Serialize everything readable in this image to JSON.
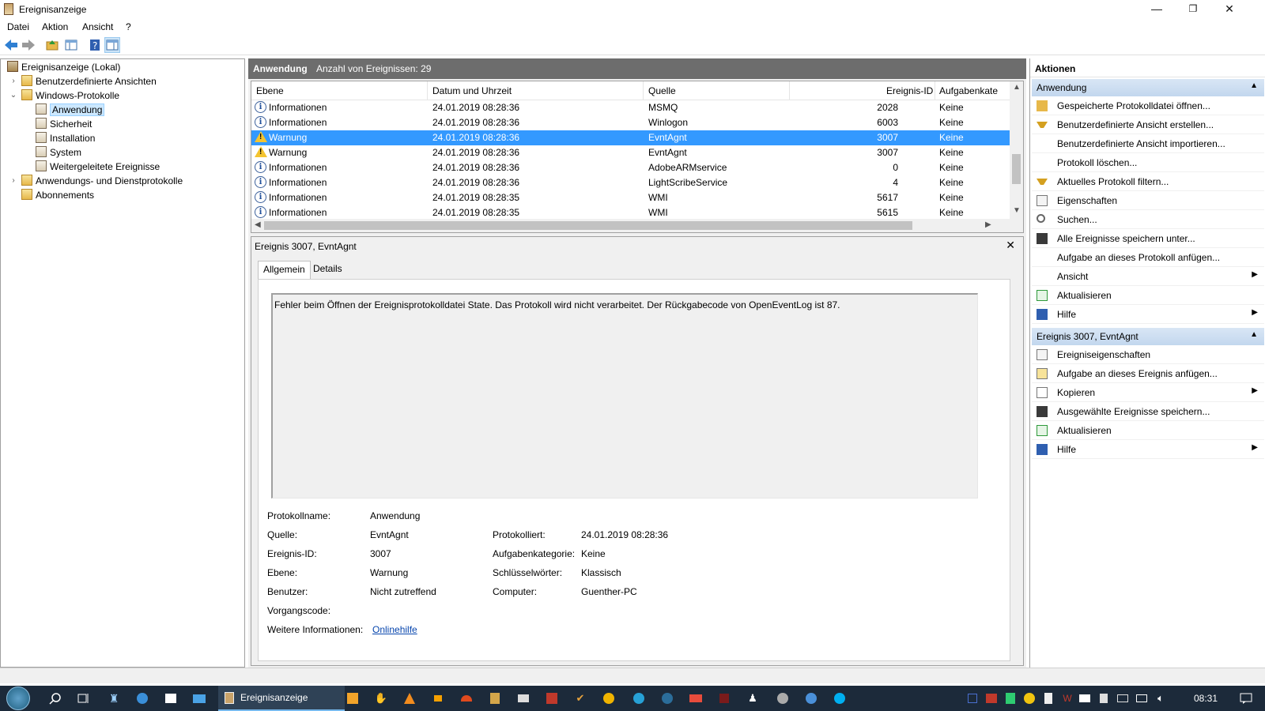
{
  "window": {
    "title": "Ereignisanzeige",
    "minimize": "—",
    "maximize": "❐",
    "close": "✕"
  },
  "menu": [
    "Datei",
    "Aktion",
    "Ansicht",
    "?"
  ],
  "tree": {
    "root": "Ereignisanzeige (Lokal)",
    "custom_views": "Benutzerdefinierte Ansichten",
    "windows_logs": "Windows-Protokolle",
    "logs": [
      "Anwendung",
      "Sicherheit",
      "Installation",
      "System",
      "Weitergeleitete Ereignisse"
    ],
    "app_service_logs": "Anwendungs- und Dienstprotokolle",
    "subscriptions": "Abonnements"
  },
  "center": {
    "header_title": "Anwendung",
    "header_count": "Anzahl von Ereignissen: 29",
    "columns": [
      "Ebene",
      "Datum und Uhrzeit",
      "Quelle",
      "Ereignis-ID",
      "Aufgabenkate"
    ],
    "rows": [
      {
        "level": "Informationen",
        "date": "24.01.2019 08:28:36",
        "source": "MSMQ",
        "id": "2028",
        "task": "Keine",
        "type": "info"
      },
      {
        "level": "Informationen",
        "date": "24.01.2019 08:28:36",
        "source": "Winlogon",
        "id": "6003",
        "task": "Keine",
        "type": "info"
      },
      {
        "level": "Warnung",
        "date": "24.01.2019 08:28:36",
        "source": "EvntAgnt",
        "id": "3007",
        "task": "Keine",
        "type": "warn"
      },
      {
        "level": "Warnung",
        "date": "24.01.2019 08:28:36",
        "source": "EvntAgnt",
        "id": "3007",
        "task": "Keine",
        "type": "warn"
      },
      {
        "level": "Informationen",
        "date": "24.01.2019 08:28:36",
        "source": "AdobeARMservice",
        "id": "0",
        "task": "Keine",
        "type": "info"
      },
      {
        "level": "Informationen",
        "date": "24.01.2019 08:28:36",
        "source": "LightScribeService",
        "id": "4",
        "task": "Keine",
        "type": "info"
      },
      {
        "level": "Informationen",
        "date": "24.01.2019 08:28:35",
        "source": "WMI",
        "id": "5617",
        "task": "Keine",
        "type": "info"
      },
      {
        "level": "Informationen",
        "date": "24.01.2019 08:28:35",
        "source": "WMI",
        "id": "5615",
        "task": "Keine",
        "type": "info"
      }
    ],
    "selected_row": 2
  },
  "detail": {
    "title": "Ereignis 3007, EvntAgnt",
    "tabs": [
      "Allgemein",
      "Details"
    ],
    "description": "Fehler beim Öffnen der Ereignisprotokolldatei State. Das Protokoll wird nicht verarbeitet. Der Rückgabecode von OpenEventLog ist 87.",
    "props": {
      "log_name_label": "Protokollname:",
      "log_name": "Anwendung",
      "source_label": "Quelle:",
      "source": "EvntAgnt",
      "logged_label": "Protokolliert:",
      "logged": "24.01.2019 08:28:36",
      "event_id_label": "Ereignis-ID:",
      "event_id": "3007",
      "task_label": "Aufgabenkategorie:",
      "task": "Keine",
      "level_label": "Ebene:",
      "level": "Warnung",
      "keywords_label": "Schlüsselwörter:",
      "keywords": "Klassisch",
      "user_label": "Benutzer:",
      "user": "Nicht zutreffend",
      "computer_label": "Computer:",
      "computer": "Guenther-PC",
      "opcode_label": "Vorgangscode:",
      "more_info_label": "Weitere Informationen:",
      "more_info_link": "Onlinehilfe"
    }
  },
  "actions": {
    "title": "Aktionen",
    "section1": "Anwendung",
    "items1": [
      {
        "label": "Gespeicherte Protokolldatei öffnen...",
        "icon": "folder-open-icon"
      },
      {
        "label": "Benutzerdefinierte Ansicht erstellen...",
        "icon": "filter-icon"
      },
      {
        "label": "Benutzerdefinierte Ansicht importieren...",
        "icon": ""
      },
      {
        "label": "Protokoll löschen...",
        "icon": ""
      },
      {
        "label": "Aktuelles Protokoll filtern...",
        "icon": "filter-icon"
      },
      {
        "label": "Eigenschaften",
        "icon": "properties-icon"
      },
      {
        "label": "Suchen...",
        "icon": "find-icon"
      },
      {
        "label": "Alle Ereignisse speichern unter...",
        "icon": "save-icon"
      },
      {
        "label": "Aufgabe an dieses Protokoll anfügen...",
        "icon": ""
      },
      {
        "label": "Ansicht",
        "icon": "",
        "sub": true
      },
      {
        "label": "Aktualisieren",
        "icon": "refresh-icon"
      },
      {
        "label": "Hilfe",
        "icon": "help-icon",
        "sub": true
      }
    ],
    "section2": "Ereignis 3007, EvntAgnt",
    "items2": [
      {
        "label": "Ereigniseigenschaften",
        "icon": "properties-icon"
      },
      {
        "label": "Aufgabe an dieses Ereignis anfügen...",
        "icon": "task-icon"
      },
      {
        "label": "Kopieren",
        "icon": "copy-icon",
        "sub": true
      },
      {
        "label": "Ausgewählte Ereignisse speichern...",
        "icon": "save-icon"
      },
      {
        "label": "Aktualisieren",
        "icon": "refresh-icon"
      },
      {
        "label": "Hilfe",
        "icon": "help-icon",
        "sub": true
      }
    ]
  },
  "taskbar": {
    "app_label": "Ereignisanzeige",
    "clock": "08:31"
  }
}
